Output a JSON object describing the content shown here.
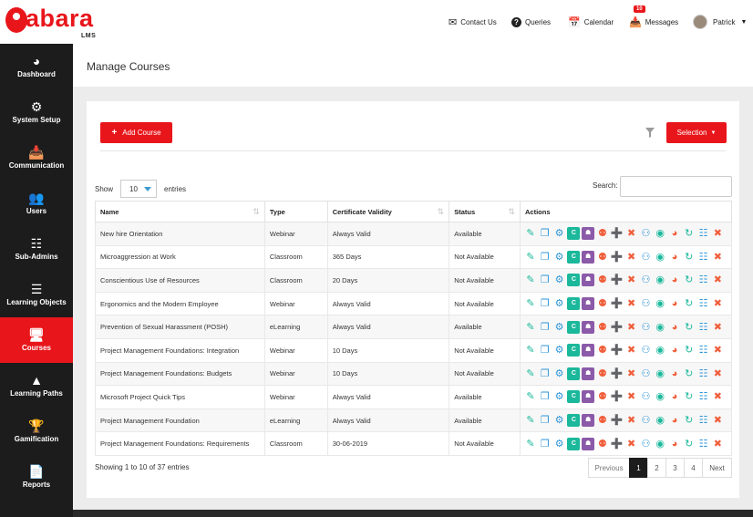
{
  "brand": {
    "name": "abara",
    "sub": "LMS"
  },
  "topnav": {
    "contact": "Contact Us",
    "queries": "Queries",
    "calendar": "Calendar",
    "messages": "Messages",
    "messages_badge": "10",
    "user": "Patrick"
  },
  "sidebar": {
    "items": [
      {
        "label": "Dashboard",
        "icon": "dashboard-icon"
      },
      {
        "label": "System Setup",
        "icon": "gear-icon"
      },
      {
        "label": "Communication",
        "icon": "inbox-icon"
      },
      {
        "label": "Users",
        "icon": "users-icon"
      },
      {
        "label": "Sub-Admins",
        "icon": "sitemap-icon"
      },
      {
        "label": "Learning Objects",
        "icon": "server-icon"
      },
      {
        "label": "Courses",
        "icon": "monitor-icon"
      },
      {
        "label": "Learning Paths",
        "icon": "road-icon"
      },
      {
        "label": "Gamification",
        "icon": "trophy-icon"
      },
      {
        "label": "Reports",
        "icon": "file-icon"
      }
    ],
    "active": "Courses"
  },
  "page": {
    "title": "Manage Courses"
  },
  "toolbar": {
    "add_label": "Add Course",
    "selection_label": "Selection"
  },
  "table_controls": {
    "show_label": "Show",
    "page_size": "10",
    "entries_label": "entries",
    "search_label": "Search:",
    "search_value": ""
  },
  "table": {
    "headers": {
      "name": "Name",
      "type": "Type",
      "validity": "Certificate Validity",
      "status": "Status",
      "actions": "Actions"
    },
    "rows": [
      {
        "name": "New hire Orientation",
        "type": "Webinar",
        "validity": "Always Valid",
        "status": "Available"
      },
      {
        "name": "Microaggression at Work",
        "type": "Classroom",
        "validity": "365 Days",
        "status": "Not Available"
      },
      {
        "name": "Conscientious Use of Resources",
        "type": "Classroom",
        "validity": "20 Days",
        "status": "Not Available"
      },
      {
        "name": "Ergonomics and the Modern Employee",
        "type": "Webinar",
        "validity": "Always Valid",
        "status": "Not Available"
      },
      {
        "name": "Prevention of Sexual Harassment (POSH)",
        "type": "eLearning",
        "validity": "Always Valid",
        "status": "Available"
      },
      {
        "name": "Project Management Foundations: Integration",
        "type": "Webinar",
        "validity": "10 Days",
        "status": "Not Available"
      },
      {
        "name": "Project Management Foundations: Budgets",
        "type": "Webinar",
        "validity": "10 Days",
        "status": "Not Available"
      },
      {
        "name": "Microsoft Project Quick Tips",
        "type": "Webinar",
        "validity": "Always Valid",
        "status": "Available"
      },
      {
        "name": "Project Management Foundation",
        "type": "eLearning",
        "validity": "Always Valid",
        "status": "Available"
      },
      {
        "name": "Project Management Foundations: Requirements",
        "type": "Classroom",
        "validity": "30-06-2019",
        "status": "Not Available"
      }
    ]
  },
  "colors": {
    "brand_red": "#e8161b",
    "sidebar_bg": "#1c1c1c",
    "action_green": "#1bb89b",
    "action_blue": "#2f96d8",
    "action_orange": "#f05f3c"
  },
  "footer": {
    "info": "Showing 1 to 10 of 37 entries",
    "prev": "Previous",
    "pages": [
      "1",
      "2",
      "3",
      "4"
    ],
    "current_page": "1",
    "next": "Next"
  }
}
